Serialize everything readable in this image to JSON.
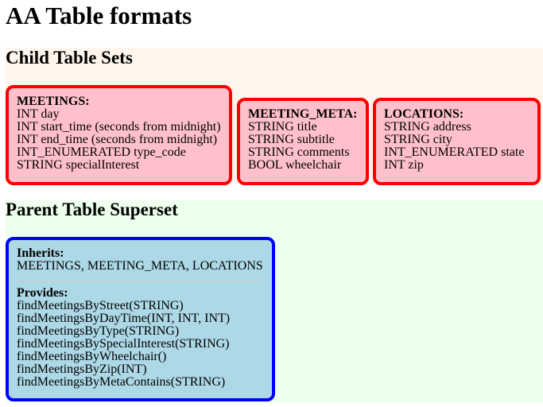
{
  "page": {
    "title": "AA Table formats"
  },
  "child_section": {
    "heading": "Child Table Sets",
    "tables": [
      {
        "name": "MEETINGS:",
        "fields": [
          "INT day",
          "INT start_time (seconds from midnight)",
          "INT end_time (seconds from midnight)",
          "INT_ENUMERATED type_code",
          "STRING specialInterest"
        ]
      },
      {
        "name": "MEETING_META:",
        "fields": [
          "STRING title",
          "STRING subtitle",
          "STRING comments",
          "BOOL wheelchair"
        ]
      },
      {
        "name": "LOCATIONS:",
        "fields": [
          "STRING address",
          "STRING city",
          "INT_ENUMERATED state",
          "INT zip"
        ]
      }
    ]
  },
  "parent_section": {
    "heading": "Parent Table Superset",
    "inherits_label": "Inherits:",
    "inherits_value": "MEETINGS, MEETING_META, LOCATIONS",
    "provides_label": "Provides:",
    "provides": [
      "findMeetingsByStreet(STRING)",
      "findMeetingsByDayTime(INT, INT, INT)",
      "findMeetingsByType(STRING)",
      "findMeetingsBySpecialInterest(STRING)",
      "findMeetingsByWheelchair()",
      "findMeetingsByZip(INT)",
      "findMeetingsByMetaContains(STRING)"
    ]
  },
  "colors": {
    "child_band": "#fff5ec",
    "parent_band": "#edffed",
    "child_box_fill": "#ffc0cb",
    "child_box_border": "#ff0000",
    "parent_box_fill": "#add8e6",
    "parent_box_border": "#0000ff"
  }
}
